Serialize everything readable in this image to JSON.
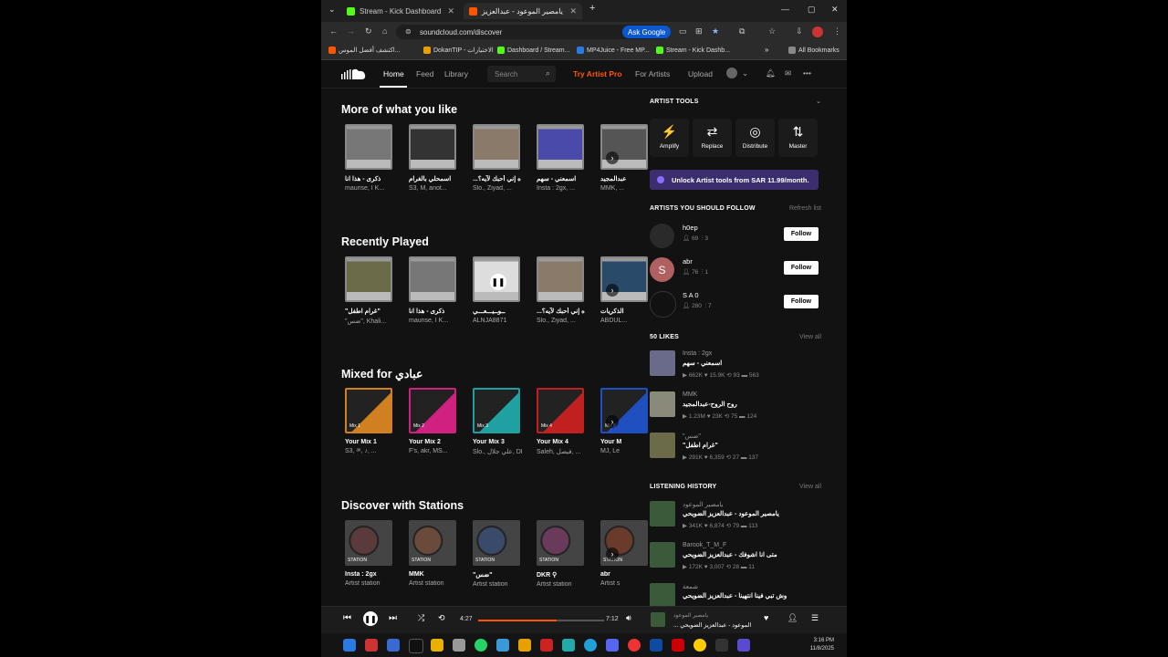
{
  "browser": {
    "tabs": [
      {
        "title": "Stream - Kick Dashboard",
        "close": "✕"
      },
      {
        "title": "يامصير الموعود - عبدالعزيز",
        "close": "✕"
      }
    ],
    "new_tab": "+",
    "url": "soundcloud.com/discover",
    "ask_google": "Ask Google",
    "bookmarks": [
      "اكتشف أفضل الموس...",
      "DokanTIP - الاختيارات",
      "Dashboard / Stream...",
      "MP4Juice - Free MP...",
      "Stream - Kick Dashb..."
    ],
    "all_bookmarks": "All Bookmarks",
    "colors": {
      "kick": "#53fc18",
      "soundcloud": "#ff5500",
      "google": "#0b57d0"
    }
  },
  "nav": {
    "home": "Home",
    "feed": "Feed",
    "library": "Library",
    "search_placeholder": "Search",
    "try_pro": "Try Artist Pro",
    "for_artists": "For Artists",
    "upload": "Upload",
    "more": "•••"
  },
  "sections": {
    "more_like": {
      "title": "More of what you like",
      "cards": [
        {
          "title": "ذكرى - هذا انا",
          "sub": "maurise, I K...",
          "color": "#777"
        },
        {
          "title": "اسمحلي بالغرام",
          "sub": "S3, M, anot...",
          "color": "#333"
        },
        {
          "title": "...ه إني أحبك لآيه؟",
          "sub": "Slo., Ziyad, ...",
          "color": "#8a7a6a"
        },
        {
          "title": "اسمعني - سهم",
          "sub": "Insta : 2gx, ...",
          "color": "#4a4aaa"
        },
        {
          "title": "عبدالمجيد",
          "sub": "MMK, ...",
          "color": "#555"
        }
      ]
    },
    "recently_played": {
      "title": "Recently Played",
      "cards": [
        {
          "title": "\"غرام اطفل\"",
          "sub": "\"ضس\", Khali...",
          "color": "#6b6b4a"
        },
        {
          "title": "ذكرى - هذا انا",
          "sub": "maurise, I K...",
          "color": "#777"
        },
        {
          "title": "ــوــيـــعـــي",
          "sub": "ALNJA8871",
          "color": "#ddd"
        },
        {
          "title": "...ه إني أحبك لآيه؟",
          "sub": "Slo., Ziyad, ...",
          "color": "#8a7a6a"
        },
        {
          "title": "الذكريات",
          "sub": "ABDUL...",
          "color": "#2a4a6a"
        }
      ]
    },
    "mixed_for": {
      "title": "Mixed for عبادي",
      "cards": [
        {
          "title": "Your Mix 1",
          "sub": "S3, ᵃᵏ, ♪, ...",
          "color": "#d08020",
          "label": "Mix 1"
        },
        {
          "title": "Your Mix 2",
          "sub": "F's, akr, MS...",
          "color": "#d02080",
          "label": "Mix 2"
        },
        {
          "title": "Your Mix 3",
          "sub": "Slo., علي جلال, DKR...",
          "color": "#20a0a0",
          "label": "Mix 3"
        },
        {
          "title": "Your Mix 4",
          "sub": "Saleh, فيصل, ...",
          "color": "#c02020",
          "label": "Mix 4"
        },
        {
          "title": "Your M",
          "sub": "MJ, Le",
          "color": "#2050c0",
          "label": "Mix 5"
        }
      ]
    },
    "stations": {
      "title": "Discover with Stations",
      "cards": [
        {
          "title": "Insta : 2gx",
          "sub": "Artist station",
          "color": "#5a3a3a"
        },
        {
          "title": "MMK",
          "sub": "Artist station",
          "color": "#6a4a3a"
        },
        {
          "title": "\"ضس\"",
          "sub": "Artist station",
          "color": "#3a4a6a"
        },
        {
          "title": "DKR ⚲",
          "sub": "Artist station",
          "color": "#6a3a5a"
        },
        {
          "title": "abr",
          "sub": "Artist s",
          "color": "#6a3a2a"
        }
      ],
      "badge": "STATION"
    }
  },
  "sidebar": {
    "artist_tools": "ARTIST TOOLS",
    "tools": [
      {
        "label": "Amplify",
        "icon": "⚡"
      },
      {
        "label": "Replace",
        "icon": "⇄"
      },
      {
        "label": "Distribute",
        "icon": "◎"
      },
      {
        "label": "Master",
        "icon": "⇅"
      }
    ],
    "unlock": "Unlock Artist tools from SAR 11.99/month.",
    "should_follow": "ARTISTS YOU SHOULD FOLLOW",
    "refresh": "Refresh list",
    "follow_label": "Follow",
    "artists": [
      {
        "name": "h0ep",
        "followers": "69",
        "tracks": "3"
      },
      {
        "name": "abr",
        "followers": "76",
        "tracks": "1",
        "initial": "S"
      },
      {
        "name": "S A 0",
        "followers": "280",
        "tracks": "7"
      }
    ],
    "likes_title": "50 LIKES",
    "view_all": "View all",
    "likes": [
      {
        "user": "Insta : 2gx",
        "title": "اسمعني - سهم",
        "plays": "662K",
        "likes": "15.9K",
        "reposts": "93",
        "comments": "563"
      },
      {
        "user": "MMK",
        "title": "روح الروح-عبدالمجيد",
        "plays": "1.23M",
        "likes": "23K",
        "reposts": "75",
        "comments": "124"
      },
      {
        "user": "\"ضس\"",
        "title": "\"غرام اطفل\"",
        "plays": "291K",
        "likes": "6,359",
        "reposts": "27",
        "comments": "137"
      }
    ],
    "history_title": "LISTENING HISTORY",
    "history": [
      {
        "user": "يامصير الموعود",
        "title": "يامصير الموعود - عبدالعزيز الضويحي",
        "plays": "341K",
        "likes": "6,874",
        "reposts": "79",
        "comments": "113"
      },
      {
        "user": "Barook_T_M_F",
        "title": "متى انا اشوفك - عبدالعزيز الضويحي",
        "plays": "172K",
        "likes": "3,007",
        "reposts": "28",
        "comments": "11"
      },
      {
        "user": "شمعة",
        "title": "وش تبي فينا انتهينا - عبدالعزيز الضويحي",
        "plays": "",
        "likes": "",
        "reposts": "",
        "comments": ""
      }
    ]
  },
  "player": {
    "elapsed": "4:27",
    "duration": "7:12",
    "progress": 0.62,
    "track_user": "يامصير الموعود",
    "track_title": "... الموعود - عبدالعزيز الضويحي"
  },
  "taskbar": {
    "time": "3:16 PM",
    "date": "11/8/2025"
  }
}
